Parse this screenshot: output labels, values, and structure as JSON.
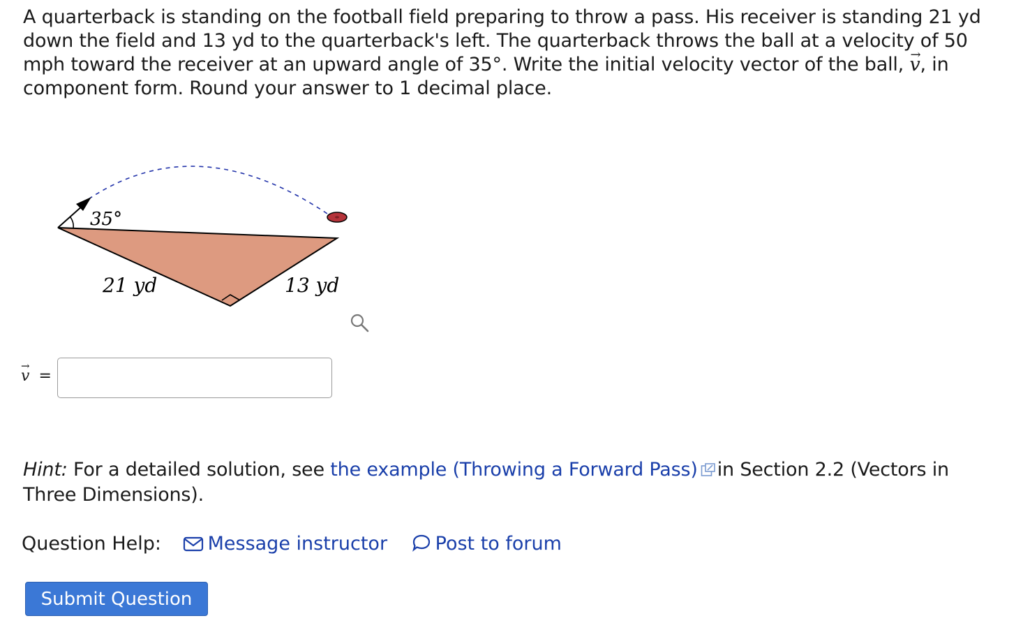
{
  "question": {
    "part1": "A quarterback is standing on the football field preparing to throw a pass. His receiver is standing 21 yd down the field and 13 yd to the quarterback's left. The quarterback throws the ball at a velocity of 50 mph toward the receiver at an upward angle of 35",
    "degree": "°",
    "part2": ". Write the initial velocity vector of the ball, ",
    "vector_symbol": "v",
    "arrow": "→",
    "part3": ", in component form. Round your answer to 1 decimal place."
  },
  "diagram": {
    "angle_label": "35°",
    "left_side_label": "21 yd",
    "right_side_label": "13 yd",
    "triangle_color": "#dd9a80",
    "ball_color": "#b5333a",
    "path_color": "#2233aa"
  },
  "answer": {
    "label_symbol": "v",
    "label_arrow": "→",
    "equals": "=",
    "value": ""
  },
  "hint": {
    "label": "Hint:",
    "text_before": " For a detailed solution, see ",
    "link_text": "the example (Throwing a Forward Pass)",
    "text_after": "in Section 2.2 (Vectors in Three Dimensions)."
  },
  "help": {
    "label": "Question Help:",
    "message_label": "Message instructor",
    "forum_label": "Post to forum"
  },
  "submit": {
    "label": "Submit Question"
  },
  "colors": {
    "link": "#1a3faa",
    "button": "#3b78d6"
  }
}
